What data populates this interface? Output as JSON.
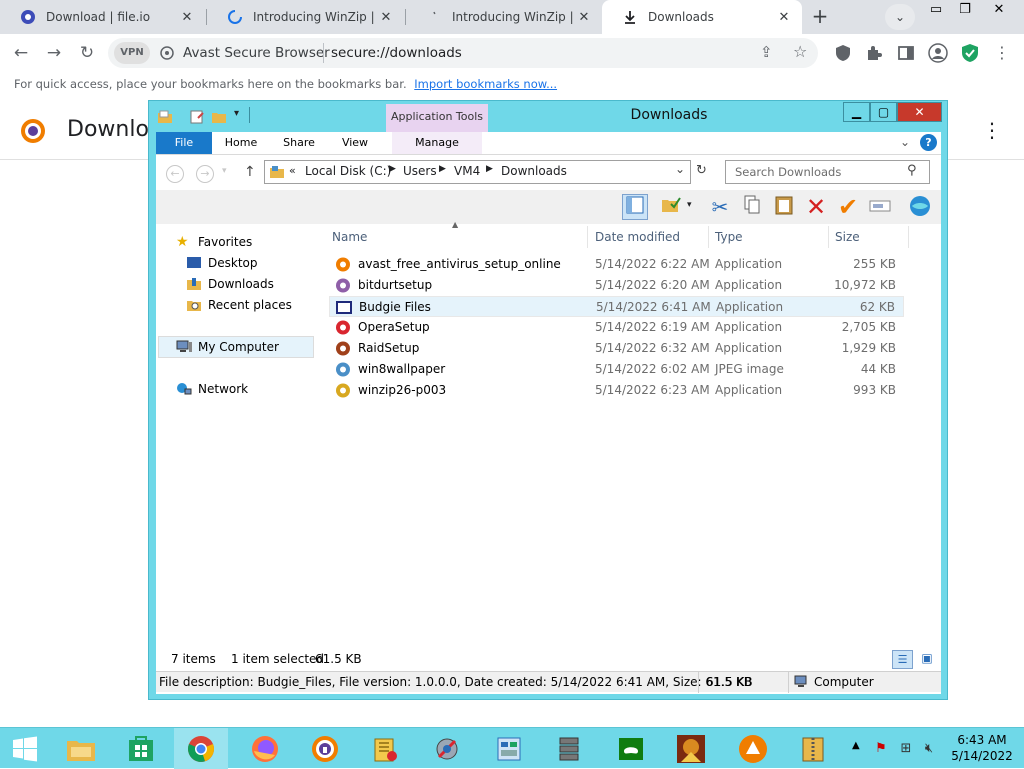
{
  "browser": {
    "tabs": [
      {
        "title": "Download | file.io"
      },
      {
        "title": "Introducing WinZip | Get"
      },
      {
        "title": "Introducing WinZip | Get"
      },
      {
        "title": "Downloads"
      }
    ],
    "vpn_label": "VPN",
    "omnibox_brand": "Avast Secure Browser",
    "omnibox_url": "secure://downloads",
    "bookmarks_bar": {
      "message": "For quick access, place your bookmarks here on the bookmarks bar.",
      "import_link": "Import bookmarks now..."
    },
    "page_title": "Downloa"
  },
  "explorer": {
    "window_title": "Downloads",
    "contextual_tab_group": "Application Tools",
    "ribbon_tabs": [
      "File",
      "Home",
      "Share",
      "View",
      "Manage"
    ],
    "address": {
      "overflow": "«",
      "segments": [
        "Local Disk (C:)",
        "Users",
        "VM4",
        "Downloads"
      ]
    },
    "search_placeholder": "Search Downloads",
    "nav": {
      "favorites": "Favorites",
      "desktop": "Desktop",
      "downloads": "Downloads",
      "recent": "Recent places",
      "computer": "My Computer",
      "network": "Network"
    },
    "columns": {
      "name": "Name",
      "date": "Date modified",
      "type": "Type",
      "size": "Size"
    },
    "files": [
      {
        "name": "avast_free_antivirus_setup_online",
        "date": "5/14/2022 6:22 AM",
        "type": "Application",
        "size": "255 KB",
        "icon": "avast-icon",
        "color": "#f07d00"
      },
      {
        "name": "bitdurtsetup",
        "date": "5/14/2022 6:20 AM",
        "type": "Application",
        "size": "10,972 KB",
        "icon": "setup-icon",
        "color": "#8f5fa8"
      },
      {
        "name": "Budgie Files",
        "date": "5/14/2022 6:41 AM",
        "type": "Application",
        "size": "62 KB",
        "icon": "window-icon",
        "color": "#1e2a7a"
      },
      {
        "name": "OperaSetup",
        "date": "5/14/2022 6:19 AM",
        "type": "Application",
        "size": "2,705 KB",
        "icon": "opera-icon",
        "color": "#d9262f"
      },
      {
        "name": "RaidSetup",
        "date": "5/14/2022 6:32 AM",
        "type": "Application",
        "size": "1,929 KB",
        "icon": "raid-icon",
        "color": "#a0401a"
      },
      {
        "name": "win8wallpaper",
        "date": "5/14/2022 6:02 AM",
        "type": "JPEG image",
        "size": "44 KB",
        "icon": "image-icon",
        "color": "#4a8fc7"
      },
      {
        "name": "winzip26-p003",
        "date": "5/14/2022 6:23 AM",
        "type": "Application",
        "size": "993 KB",
        "icon": "winzip-icon",
        "color": "#d8a820"
      }
    ],
    "status": {
      "count": "7 items",
      "selection": "1 item selected",
      "sel_size": "61.5 KB"
    },
    "details_bar": {
      "description": "File description: Budgie_Files, File version: 1.0.0.0, Date created: 5/14/2022 6:41 AM, Size: 61.5 KB",
      "size": "61.5 KB",
      "location": "Computer"
    }
  },
  "taskbar": {
    "clock_time": "6:43 AM",
    "clock_date": "5/14/2022"
  },
  "colors": {
    "explorer_frame": "#6fd8e8",
    "close_button": "#c7392b",
    "file_tab": "#1979ca",
    "context_tab": "#e8d3f0"
  }
}
